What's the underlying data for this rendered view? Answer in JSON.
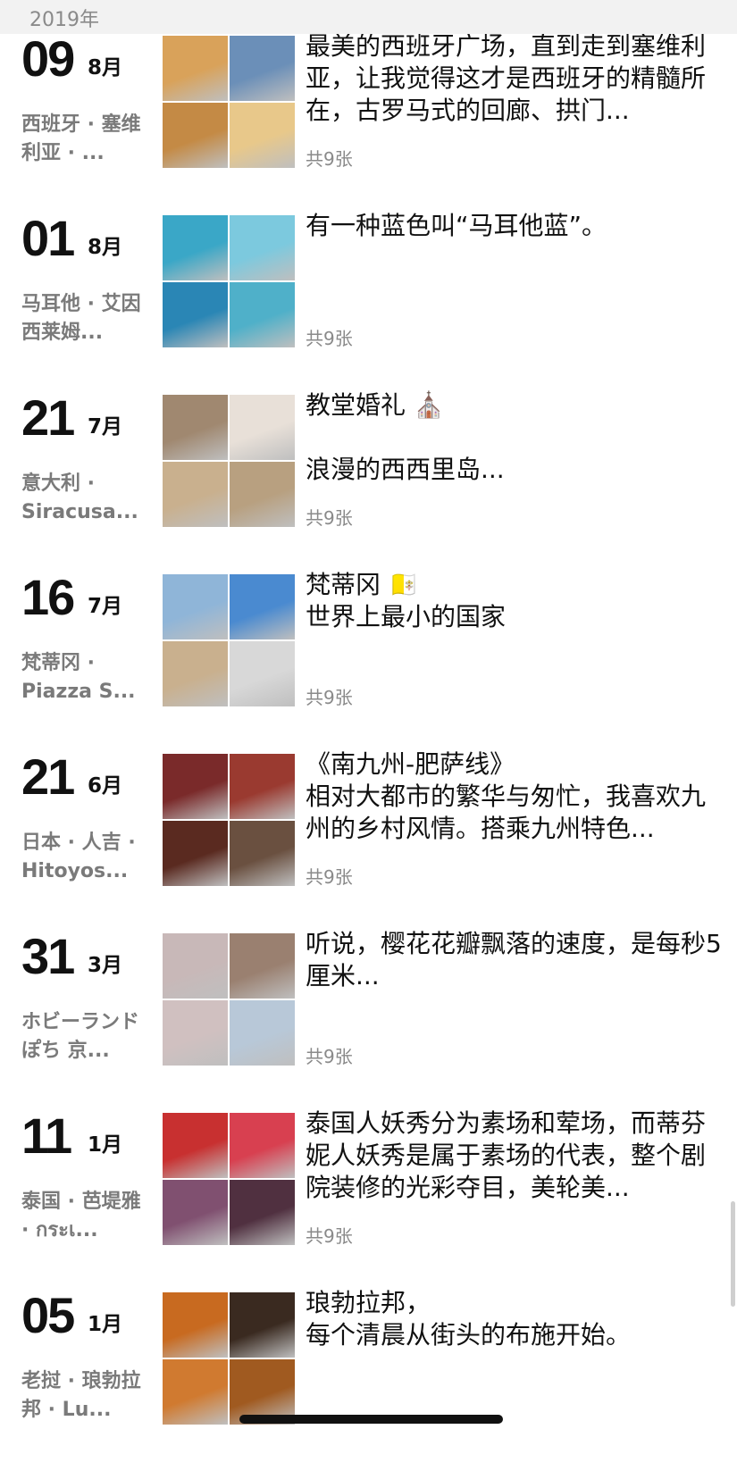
{
  "year_header": "2019年",
  "entries": [
    {
      "day": "09",
      "month": "8月",
      "location": "西班牙 · 塞维利亚 · ...",
      "caption": "最美的西班牙广场，直到走到塞维利亚，让我觉得这才是西班牙的精髓所在，古罗马式的回廊、拱门...",
      "count": "共9张",
      "palette": [
        "#d9a25a",
        "#6b8fb8",
        "#c48a45",
        "#e8c88a"
      ]
    },
    {
      "day": "01",
      "month": "8月",
      "location": "马耳他 · 艾因西莱姆...",
      "caption": "有一种蓝色叫“马耳他蓝”。",
      "count": "共9张",
      "palette": [
        "#3aa7c7",
        "#7cc9de",
        "#2a86b5",
        "#4fb0c9"
      ]
    },
    {
      "day": "21",
      "month": "7月",
      "location": "意大利 · Siracusa...",
      "caption": "教堂婚礼 ⛪\n\n浪漫的西西里岛...",
      "count": "共9张",
      "palette": [
        "#a08870",
        "#e8e0d8",
        "#c9b08e",
        "#b8a080"
      ]
    },
    {
      "day": "16",
      "month": "7月",
      "location": "梵蒂冈 · Piazza S...",
      "caption": "梵蒂冈 🇻🇦\n世界上最小的国家",
      "count": "共9张",
      "palette": [
        "#8fb5d8",
        "#4a8ad0",
        "#c9b08e",
        "#d8d8d8"
      ]
    },
    {
      "day": "21",
      "month": "6月",
      "location": "日本 · 人吉 · Hitoyos...",
      "caption": "《南九州-肥萨线》\n相对大都市的繁华与匆忙，我喜欢九州的乡村风情。搭乘九州特色...",
      "count": "共9张",
      "palette": [
        "#7a2a2a",
        "#9a3a30",
        "#5a2a20",
        "#6a5040"
      ]
    },
    {
      "day": "31",
      "month": "3月",
      "location": "ホビーランドぽち 京...",
      "caption": "听说，樱花花瓣飘落的速度，是每秒5厘米...",
      "count": "共9张",
      "palette": [
        "#c8b8b8",
        "#9a8070",
        "#d0c0c0",
        "#b8c8d8"
      ]
    },
    {
      "day": "11",
      "month": "1月",
      "location": "泰国 · 芭堤雅 · กระเ...",
      "caption": "泰国人妖秀分为素场和荤场，而蒂芬妮人妖秀是属于素场的代表，整个剧院装修的光彩夺目，美轮美...",
      "count": "共9张",
      "palette": [
        "#c83030",
        "#d84050",
        "#805070",
        "#503040"
      ]
    },
    {
      "day": "05",
      "month": "1月",
      "location": "老挝 · 琅勃拉邦 · Lu...",
      "caption": "琅勃拉邦，\n每个清晨从街头的布施开始。",
      "count": "",
      "palette": [
        "#c86a20",
        "#3a2a20",
        "#d07a30",
        "#a05a20"
      ]
    }
  ],
  "colors": {
    "header_bg": "#f2f2f2",
    "muted_text": "#8a8a8a",
    "location_text": "#7a7a7a"
  }
}
